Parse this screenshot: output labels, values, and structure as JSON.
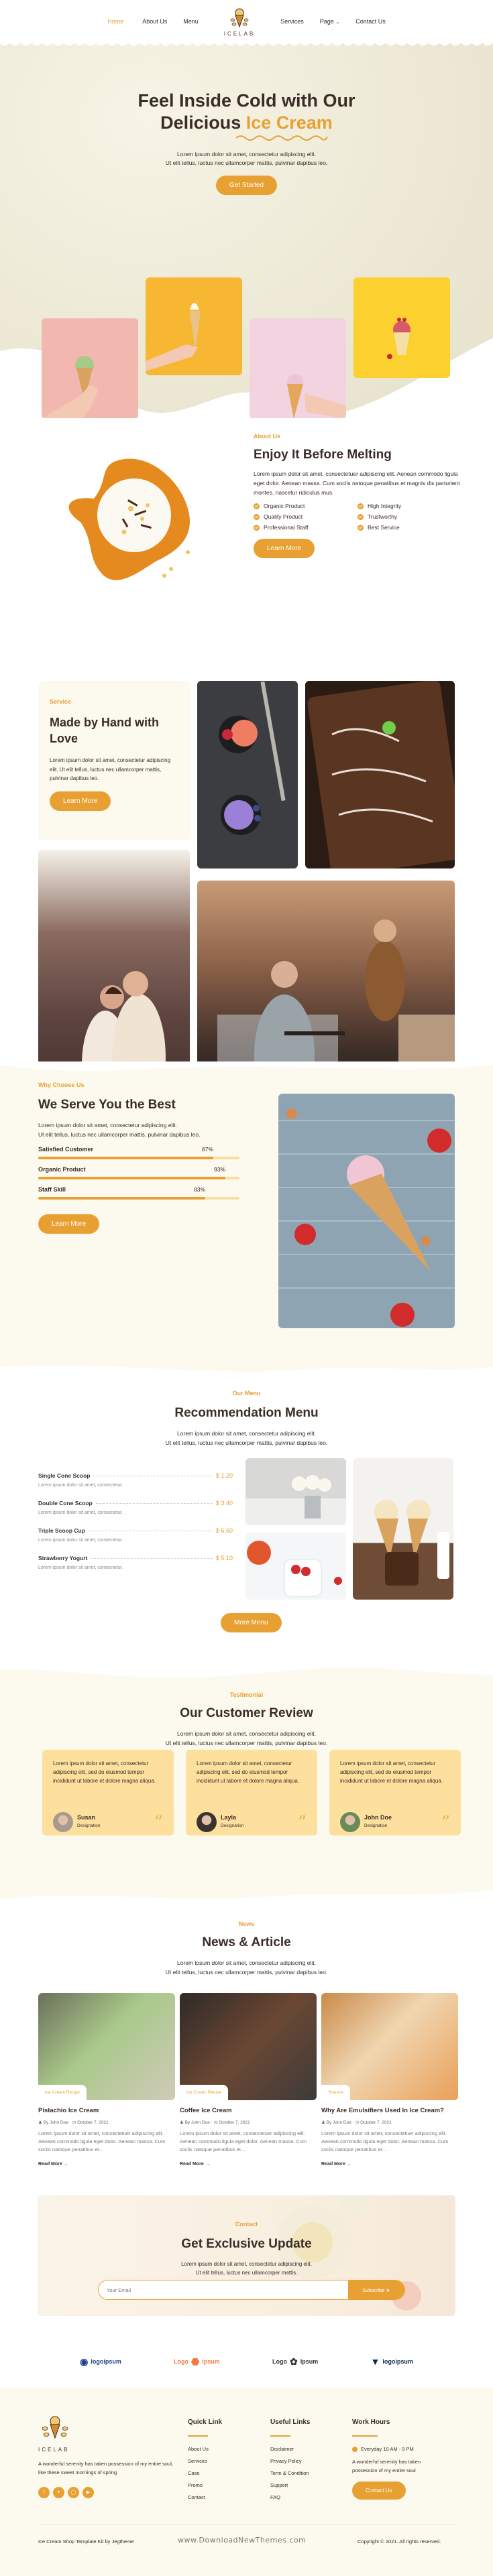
{
  "brand": {
    "name": "ICELAB",
    "accent": "#e8a033",
    "dark": "#3a2c27",
    "cream": "#fcf9ef"
  },
  "nav": {
    "left": [
      {
        "label": "Home",
        "active": true
      },
      {
        "label": "About Us"
      },
      {
        "label": "Menu"
      }
    ],
    "right": [
      {
        "label": "Services"
      },
      {
        "label": "Page",
        "dropdown": true
      },
      {
        "label": "Contact Us"
      }
    ],
    "logo_text": "ICELAB"
  },
  "hero": {
    "title_line1": "Feel Inside Cold with Our",
    "title_line2_prefix": "Delicious ",
    "title_highlight": "Ice Cream",
    "subtitle_line1": "Lorem ipsum dolor sit amet, consectetur adipiscing elit.",
    "subtitle_line2": "Ut elit tellus, luctus nec ullamcorper mattis, pulvinar dapibus leo.",
    "cta": "Get Started",
    "cards": [
      {
        "name": "pistachio-cone-photo",
        "bg": "#f2b8b0"
      },
      {
        "name": "soft-serve-cone-photo",
        "bg": "#f7b733"
      },
      {
        "name": "strawberry-cone-photo",
        "bg": "#f3d3e0"
      },
      {
        "name": "raspberry-sorbet-photo",
        "bg": "#fbd02f"
      }
    ]
  },
  "about": {
    "kicker": "About Us",
    "title": "Enjoy It Before Melting",
    "body": "Lorem ipsum dolor sit amet, consectetuer adipiscing elit. Aenean commodo ligula eget dolor. Aenean massa. Cum sociis natoque penatibus et magnis dis parturient montes, nascetur ridiculus mus.",
    "features": [
      "Organic Product",
      "High Integrity",
      "Quality Product",
      "Trustworthy",
      "Professional Staff",
      "Best Service"
    ],
    "cta": "Learn More"
  },
  "service": {
    "kicker": "Service",
    "title": "Made by Hand with Love",
    "body": "Lorem ipsum dolor sit amet, consectetur adipiscing elit. Ut elit tellus, luctus nec ullamcorper mattis, pulvinar dapibus leo.",
    "cta": "Learn More"
  },
  "why": {
    "kicker": "Why Choose Us",
    "title": "We Serve You the Best",
    "body_line1": "Lorem ipsum dolor sit amet, consectetur adipiscing elit.",
    "body_line2": "Ut elit tellus, luctus nec ullamcorper mattis, pulvinar dapibus leo.",
    "bars": [
      {
        "label": "Satisfied Customer",
        "value": 87,
        "text": "87%"
      },
      {
        "label": "Organic Product",
        "value": 93,
        "text": "93%"
      },
      {
        "label": "Staff Skill",
        "value": 83,
        "text": "83%"
      }
    ],
    "cta": "Learn More"
  },
  "menu": {
    "kicker": "Our Menu",
    "title": "Recommendation Menu",
    "sub_line1": "Lorem ipsum dolor sit amet, consectetur adipiscing elit.",
    "sub_line2": "Ut elit tellus, luctus nec ullamcorper mattis, pulvinar dapibus leo.",
    "items": [
      {
        "name": "Single Cone Scoop",
        "price": "$ 1.20",
        "desc": "Lorem ipsum dolor sit amet, consectetur."
      },
      {
        "name": "Double Cone Scoop",
        "price": "$ 3.40",
        "desc": "Lorem ipsum dolor sit amet, consectetur."
      },
      {
        "name": "Triple Scoop Cup",
        "price": "$ 6.60",
        "desc": "Lorem ipsum dolor sit amet, consectetur."
      },
      {
        "name": "Strawberry Yogurt",
        "price": "$ 5.10",
        "desc": "Lorem ipsum dolor sit amet, consectetur."
      }
    ],
    "cta": "More Menu"
  },
  "testimonial": {
    "kicker": "Testimonial",
    "title": "Our Customer Review",
    "sub_line1": "Lorem ipsum dolor sit amet, consectetur adipiscing elit.",
    "sub_line2": "Ut elit tellus, luctus nec ullamcorper mattis, pulvinar dapibus leo.",
    "reviews": [
      {
        "text": "Lorem ipsum dolor sit amet, consectetur adipiscing elit, sed do eiusmod tempor incididunt ut labore et dolore magna aliqua.",
        "name": "Susan",
        "designation": "Designation"
      },
      {
        "text": "Lorem ipsum dolor sit amet, consectetur adipiscing elit, sed do eiusmod tempor incididunt ut labore et dolore magna aliqua.",
        "name": "Layla",
        "designation": "Designation"
      },
      {
        "text": "Lorem ipsum dolor sit amet, consectetur adipiscing elit, sed do eiusmod tempor incididunt ut labore et dolore magna aliqua.",
        "name": "John Doe",
        "designation": "Designation"
      }
    ]
  },
  "news": {
    "kicker": "News",
    "title": "News & Article",
    "sub_line1": "Lorem ipsum dolor sit amet, consectetur adipiscing elit.",
    "sub_line2": "Ut elit tellus, luctus nec ullamcorper mattis, pulvinar dapibus leo.",
    "articles": [
      {
        "tag": "Ice Cream Recipe",
        "title": "Pistachio Ice Cream",
        "author": "By John Doe",
        "date": "October 7, 2021",
        "excerpt": "Lorem ipsum dolor sit amet, consectetuer adipiscing elit. Aenean commodo ligula eget dolor. Aenean massa. Cum sociis natoque penatibus et...",
        "more": "Read More →"
      },
      {
        "tag": "Ice Cream Recipe",
        "title": "Coffee Ice Cream",
        "author": "By John Doe",
        "date": "October 7, 2021",
        "excerpt": "Lorem ipsum dolor sit amet, consectetuer adipiscing elit. Aenean commodo ligula eget dolor. Aenean massa. Cum sociis natoque penatibus et...",
        "more": "Read More →"
      },
      {
        "tag": "Science",
        "title": "Why Are Emulsifiers Used In Ice Cream?",
        "author": "By John Doe",
        "date": "October 7, 2021",
        "excerpt": "Lorem ipsum dolor sit amet, consectetuer adipiscing elit. Aenean commodo ligula eget dolor. Aenean massa. Cum sociis natoque penatibus et...",
        "more": "Read More →"
      }
    ]
  },
  "subscribe": {
    "kicker": "Contact",
    "title": "Get Exclusive Update",
    "sub_line1": "Lorem ipsum dolor sit amet, consectetur adipiscing elit.",
    "sub_line2": "Ut elit tellus, luctus nec ullamcorper mattis.",
    "placeholder": "Your Email",
    "button": "Subscribe"
  },
  "partners": [
    {
      "pre": "",
      "text": "logoipsum",
      "color": "#1f3c88"
    },
    {
      "pre": "Logo",
      "text": "ipsum",
      "color": "#f07b3f"
    },
    {
      "pre": "Logo",
      "text": "Ipsum",
      "color": "#333333"
    },
    {
      "pre": "",
      "text": "logoipsum",
      "color": "#0b2a4a"
    }
  ],
  "footer": {
    "logo_text": "ICELAB",
    "about": "A wonderful serenity has taken possession of my entire soul, like these sweet mornings of spring",
    "social": [
      "facebook",
      "twitter",
      "instagram",
      "youtube"
    ],
    "quick_title": "Quick Link",
    "quick_links": [
      "About Us",
      "Services",
      "Case",
      "Promo",
      "Contact"
    ],
    "useful_title": "Useful Links",
    "useful_links": [
      "Disclaimer",
      "Privacy Policy",
      "Term & Condition",
      "Support",
      "FAQ"
    ],
    "hours_title": "Work Hours",
    "hours": "Everyday 10 AM - 9 PM",
    "hours_text": "A wonderful serenity has taken possession of my entire soul",
    "contact_button": "Contact Us",
    "credit": "Ice Cream Shop Template Kit by Jegtheme",
    "watermark": "www.DownloadNewThemes.com",
    "copyright": "Copyright © 2021. All rights reserved."
  }
}
